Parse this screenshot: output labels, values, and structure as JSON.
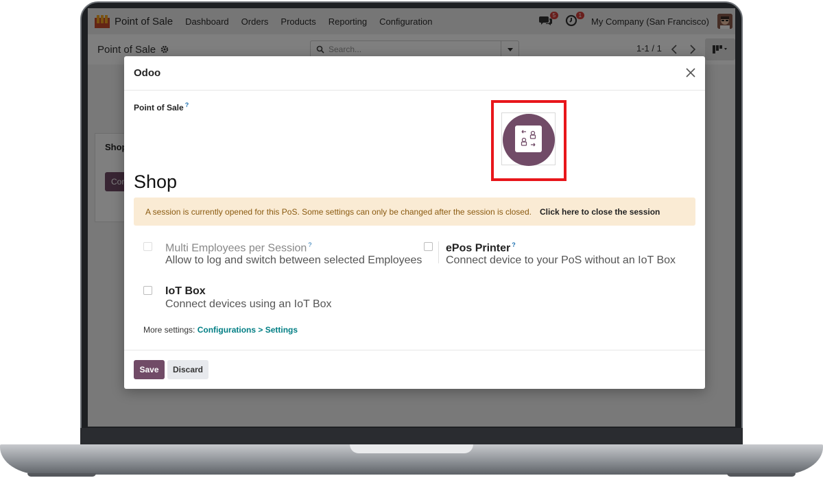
{
  "colors": {
    "brand": "#714b67",
    "highlight": "#e8161b",
    "alert_bg": "#faebd4",
    "link": "#017e84"
  },
  "topbar": {
    "app_title": "Point of Sale",
    "menu": [
      "Dashboard",
      "Orders",
      "Products",
      "Reporting",
      "Configuration"
    ],
    "messages_count": "5",
    "activities_count": "1",
    "company": "My Company (San Francisco)"
  },
  "control": {
    "breadcrumb": "Point of Sale",
    "search_placeholder": "Search...",
    "pager": "1-1 / 1"
  },
  "background_card": {
    "title": "Shop",
    "button": "Con"
  },
  "modal": {
    "title": "Odoo",
    "field_label": "Point of Sale",
    "help_mark": "?",
    "shop_name": "Shop",
    "alert_message": "A session is currently opened for this PoS. Some settings can only be changed after the session is closed.",
    "alert_link": "Click here to close the session",
    "settings": [
      {
        "title": "Multi Employees per Session",
        "desc": "Allow to log and switch between selected Employees"
      },
      {
        "title": "ePos Printer",
        "desc": "Connect device to your PoS without an IoT Box"
      },
      {
        "title": "IoT Box",
        "desc": "Connect devices using an IoT Box"
      }
    ],
    "more_settings_label": "More settings:",
    "more_settings_link": "Configurations > Settings",
    "save": "Save",
    "discard": "Discard"
  }
}
